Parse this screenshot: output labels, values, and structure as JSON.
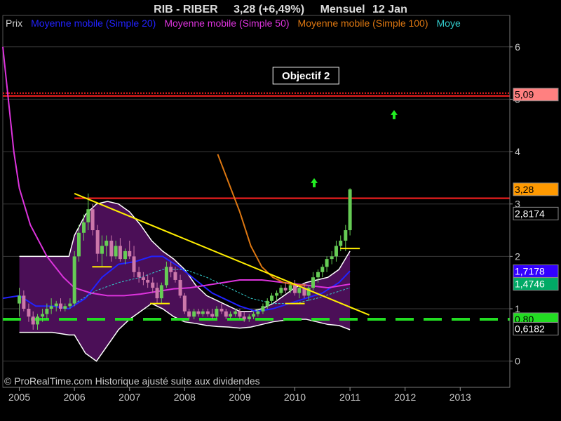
{
  "header": {
    "symbol": "RIB - RIBER",
    "quote": "3,28 (+6,49%)",
    "period": "Mensuel",
    "date": "12 Jan"
  },
  "legend": [
    {
      "label": "Prix",
      "color": "#cccccc"
    },
    {
      "label": "Moyenne mobile (Simple 20)",
      "color": "#2222ff"
    },
    {
      "label": "Moyenne mobile (Simple 50)",
      "color": "#dd33dd"
    },
    {
      "label": "Moyenne mobile (Simple 100)",
      "color": "#dd7711"
    },
    {
      "label": "Moye",
      "color": "#33cccc"
    }
  ],
  "copyright": "© ProRealTime.com Historique ajusté suite aux dividendes",
  "annotation": "Objectif 2",
  "colors": {
    "background": "#000000",
    "bollinger_fill": "#4b0f57",
    "up_candle": "#66cc55",
    "down_candle": "#cc77aa",
    "ma20": "#2222ff",
    "ma50": "#dd33dd",
    "ma100": "#dd7711",
    "ma_cyan": "#33cccc",
    "target_line": "#ff2020",
    "resistance_line": "#ff2020",
    "support_line": "#22dd22",
    "trendline": "#ffee00",
    "arrow": "#22ee22"
  },
  "chart_data": {
    "type": "candlestick",
    "x_axis": {
      "ticks": [
        "2005",
        "2006",
        "2007",
        "2008",
        "2009",
        "2010",
        "2011",
        "2012",
        "2013"
      ],
      "range": [
        2004.7,
        2013.9
      ]
    },
    "y_axis": {
      "ticks": [
        0,
        1,
        2,
        3,
        4,
        5,
        6
      ],
      "tick_labels": [
        "0",
        "1",
        "2",
        "3",
        "4",
        "5",
        "6"
      ],
      "range": [
        -0.5,
        6.6
      ],
      "position": "right"
    },
    "grid": true,
    "price_labels": [
      {
        "text": "5,09",
        "value": 5.09,
        "bg": "#ff8080",
        "fg": "#000000"
      },
      {
        "text": "3,28",
        "value": 3.28,
        "bg": "#ff9900",
        "fg": "#000000"
      },
      {
        "text": "2,8174",
        "value": 2.8174,
        "bg": "#000000",
        "fg": "#ffffff"
      },
      {
        "text": "1,7178",
        "value": 1.7178,
        "bg": "#3300ff",
        "fg": "#ffffff"
      },
      {
        "text": "1,4746",
        "value": 1.4746,
        "bg": "#00aa66",
        "fg": "#ffffff"
      },
      {
        "text": "0,80",
        "value": 0.8,
        "bg": "#22dd22",
        "fg": "#000000"
      },
      {
        "text": "0,6182",
        "value": 0.6182,
        "bg": "#000000",
        "fg": "#ffffff"
      }
    ],
    "hlines": [
      {
        "name": "objectif",
        "value": 5.09,
        "style": "double-dotted"
      },
      {
        "name": "resistance",
        "value": 3.11,
        "from_x": 2006.0,
        "style": "solid"
      },
      {
        "name": "support",
        "value": 0.8,
        "style": "dashed"
      }
    ],
    "trendline": {
      "x": [
        2006.0,
        2011.35
      ],
      "y": [
        3.2,
        0.88
      ]
    },
    "arrows": [
      {
        "x": 2010.35,
        "y": 3.4
      },
      {
        "x": 2011.8,
        "y": 4.7
      }
    ],
    "annotation_pos": {
      "x": 2010.2,
      "y": 5.45
    },
    "bollinger": {
      "x": [
        2005.0,
        2005.3,
        2005.6,
        2005.9,
        2006.0,
        2006.2,
        2006.4,
        2006.6,
        2006.8,
        2007.0,
        2007.2,
        2007.4,
        2007.6,
        2007.8,
        2008.0,
        2008.2,
        2008.4,
        2008.6,
        2008.8,
        2009.0,
        2009.2,
        2009.4,
        2009.6,
        2009.8,
        2010.0,
        2010.2,
        2010.4,
        2010.6,
        2010.8,
        2011.0
      ],
      "upper": [
        2.0,
        2.0,
        2.0,
        2.0,
        2.4,
        2.8,
        3.0,
        3.05,
        3.0,
        2.85,
        2.6,
        2.3,
        2.1,
        1.95,
        1.75,
        1.45,
        1.25,
        1.15,
        1.05,
        0.95,
        0.95,
        1.0,
        1.1,
        1.25,
        1.4,
        1.5,
        1.55,
        1.6,
        1.75,
        2.1
      ],
      "lower": [
        0.55,
        0.55,
        0.55,
        0.5,
        0.5,
        0.15,
        0.0,
        0.3,
        0.6,
        0.8,
        0.95,
        1.1,
        1.0,
        0.85,
        0.75,
        0.72,
        0.68,
        0.66,
        0.65,
        0.63,
        0.65,
        0.7,
        0.75,
        0.78,
        0.8,
        0.8,
        0.75,
        0.7,
        0.68,
        0.6
      ]
    },
    "series": [
      {
        "name": "Moyenne mobile (Simple 20)",
        "color_key": "ma20",
        "x": [
          2004.7,
          2005.0,
          2005.3,
          2005.6,
          2005.9,
          2006.2,
          2006.5,
          2006.8,
          2007.1,
          2007.4,
          2007.6,
          2007.9,
          2008.2,
          2008.5,
          2008.8,
          2009.0,
          2009.3,
          2009.6,
          2009.9,
          2010.2,
          2010.5,
          2010.8,
          2011.0
        ],
        "y": [
          1.2,
          1.25,
          1.05,
          1.05,
          1.0,
          1.2,
          1.6,
          1.85,
          1.9,
          2.0,
          2.0,
          1.8,
          1.55,
          1.3,
          1.15,
          1.05,
          0.95,
          1.0,
          1.1,
          1.2,
          1.3,
          1.5,
          1.72
        ]
      },
      {
        "name": "Moyenne mobile (Simple 50)",
        "color_key": "ma50",
        "x": [
          2004.7,
          2004.8,
          2004.9,
          2005.0,
          2005.2,
          2005.5,
          2005.8,
          2006.0,
          2006.3,
          2006.6,
          2006.9,
          2007.2,
          2007.5,
          2007.8,
          2008.1,
          2008.4,
          2008.7,
          2009.0,
          2009.4,
          2009.8,
          2010.2,
          2010.6,
          2011.0
        ],
        "y": [
          6.0,
          5.0,
          4.0,
          3.3,
          2.6,
          2.0,
          1.6,
          1.4,
          1.3,
          1.25,
          1.25,
          1.28,
          1.33,
          1.38,
          1.4,
          1.45,
          1.5,
          1.55,
          1.55,
          1.5,
          1.45,
          1.4,
          1.47
        ]
      },
      {
        "name": "Moyenne mobile (Simple 100)",
        "color_key": "ma100",
        "x": [
          2008.6,
          2008.8,
          2009.0,
          2009.2,
          2009.4,
          2009.6,
          2009.8,
          2010.0,
          2010.2
        ],
        "y": [
          3.95,
          3.4,
          2.85,
          2.2,
          1.8,
          1.6,
          1.5,
          1.45,
          1.45
        ]
      },
      {
        "name": "Moye",
        "color_key": "ma_cyan",
        "x": [
          2006.0,
          2006.4,
          2006.8,
          2007.2,
          2007.6,
          2008.0,
          2008.4,
          2008.8,
          2009.2,
          2009.6,
          2010.0,
          2010.4,
          2011.0
        ],
        "y": [
          1.1,
          1.35,
          1.5,
          1.6,
          1.75,
          1.75,
          1.6,
          1.4,
          1.2,
          1.1,
          1.1,
          1.2,
          1.4
        ]
      }
    ],
    "candles": [
      {
        "x": 2005.0,
        "o": 1.1,
        "h": 1.4,
        "l": 0.85,
        "c": 1.25
      },
      {
        "x": 2005.08,
        "o": 1.25,
        "h": 1.35,
        "l": 0.95,
        "c": 1.0
      },
      {
        "x": 2005.17,
        "o": 1.0,
        "h": 1.1,
        "l": 0.75,
        "c": 0.85
      },
      {
        "x": 2005.25,
        "o": 0.85,
        "h": 0.95,
        "l": 0.6,
        "c": 0.7
      },
      {
        "x": 2005.33,
        "o": 0.7,
        "h": 0.9,
        "l": 0.6,
        "c": 0.85
      },
      {
        "x": 2005.42,
        "o": 0.85,
        "h": 1.0,
        "l": 0.75,
        "c": 0.9
      },
      {
        "x": 2005.5,
        "o": 0.9,
        "h": 1.1,
        "l": 0.8,
        "c": 1.0
      },
      {
        "x": 2005.58,
        "o": 1.0,
        "h": 1.2,
        "l": 0.9,
        "c": 1.05
      },
      {
        "x": 2005.67,
        "o": 1.05,
        "h": 1.15,
        "l": 0.95,
        "c": 1.1
      },
      {
        "x": 2005.75,
        "o": 1.1,
        "h": 1.2,
        "l": 0.95,
        "c": 1.0
      },
      {
        "x": 2005.83,
        "o": 1.0,
        "h": 1.1,
        "l": 0.95,
        "c": 1.05
      },
      {
        "x": 2005.92,
        "o": 1.05,
        "h": 1.2,
        "l": 1.0,
        "c": 1.1
      },
      {
        "x": 2006.0,
        "o": 1.1,
        "h": 2.1,
        "l": 1.05,
        "c": 2.0
      },
      {
        "x": 2006.08,
        "o": 2.0,
        "h": 2.6,
        "l": 1.9,
        "c": 2.45
      },
      {
        "x": 2006.17,
        "o": 2.45,
        "h": 2.8,
        "l": 2.3,
        "c": 2.65
      },
      {
        "x": 2006.25,
        "o": 2.65,
        "h": 3.2,
        "l": 2.5,
        "c": 2.9
      },
      {
        "x": 2006.33,
        "o": 2.9,
        "h": 3.0,
        "l": 2.4,
        "c": 2.5
      },
      {
        "x": 2006.42,
        "o": 2.5,
        "h": 2.6,
        "l": 1.9,
        "c": 2.05
      },
      {
        "x": 2006.5,
        "o": 2.05,
        "h": 2.4,
        "l": 1.8,
        "c": 2.2
      },
      {
        "x": 2006.58,
        "o": 2.2,
        "h": 2.4,
        "l": 2.0,
        "c": 2.3
      },
      {
        "x": 2006.67,
        "o": 2.3,
        "h": 2.4,
        "l": 1.9,
        "c": 2.0
      },
      {
        "x": 2006.75,
        "o": 2.0,
        "h": 2.3,
        "l": 1.95,
        "c": 2.2
      },
      {
        "x": 2006.83,
        "o": 2.2,
        "h": 2.35,
        "l": 1.9,
        "c": 1.95
      },
      {
        "x": 2006.92,
        "o": 1.95,
        "h": 2.15,
        "l": 1.85,
        "c": 2.1
      },
      {
        "x": 2007.0,
        "o": 2.1,
        "h": 2.3,
        "l": 1.95,
        "c": 2.0
      },
      {
        "x": 2007.08,
        "o": 2.0,
        "h": 2.2,
        "l": 1.6,
        "c": 1.7
      },
      {
        "x": 2007.17,
        "o": 1.7,
        "h": 1.8,
        "l": 1.5,
        "c": 1.6
      },
      {
        "x": 2007.25,
        "o": 1.6,
        "h": 1.7,
        "l": 1.45,
        "c": 1.55
      },
      {
        "x": 2007.33,
        "o": 1.55,
        "h": 1.65,
        "l": 1.4,
        "c": 1.5
      },
      {
        "x": 2007.42,
        "o": 1.5,
        "h": 1.6,
        "l": 1.3,
        "c": 1.4
      },
      {
        "x": 2007.5,
        "o": 1.4,
        "h": 1.5,
        "l": 1.1,
        "c": 1.2
      },
      {
        "x": 2007.58,
        "o": 1.2,
        "h": 1.5,
        "l": 1.1,
        "c": 1.45
      },
      {
        "x": 2007.67,
        "o": 1.45,
        "h": 1.9,
        "l": 1.4,
        "c": 1.8
      },
      {
        "x": 2007.75,
        "o": 1.8,
        "h": 1.9,
        "l": 1.6,
        "c": 1.7
      },
      {
        "x": 2007.83,
        "o": 1.7,
        "h": 1.8,
        "l": 1.5,
        "c": 1.55
      },
      {
        "x": 2007.92,
        "o": 1.55,
        "h": 1.65,
        "l": 1.2,
        "c": 1.25
      },
      {
        "x": 2008.0,
        "o": 1.25,
        "h": 1.3,
        "l": 0.9,
        "c": 0.95
      },
      {
        "x": 2008.08,
        "o": 0.95,
        "h": 1.0,
        "l": 0.8,
        "c": 0.85
      },
      {
        "x": 2008.17,
        "o": 0.85,
        "h": 1.0,
        "l": 0.8,
        "c": 0.95
      },
      {
        "x": 2008.25,
        "o": 0.95,
        "h": 1.0,
        "l": 0.85,
        "c": 0.9
      },
      {
        "x": 2008.33,
        "o": 0.9,
        "h": 1.0,
        "l": 0.85,
        "c": 0.95
      },
      {
        "x": 2008.42,
        "o": 0.95,
        "h": 1.0,
        "l": 0.85,
        "c": 0.9
      },
      {
        "x": 2008.5,
        "o": 0.9,
        "h": 1.0,
        "l": 0.8,
        "c": 0.85
      },
      {
        "x": 2008.58,
        "o": 0.85,
        "h": 1.05,
        "l": 0.8,
        "c": 1.0
      },
      {
        "x": 2008.67,
        "o": 1.0,
        "h": 1.1,
        "l": 0.9,
        "c": 0.95
      },
      {
        "x": 2008.75,
        "o": 0.95,
        "h": 1.0,
        "l": 0.8,
        "c": 0.85
      },
      {
        "x": 2008.83,
        "o": 0.85,
        "h": 0.95,
        "l": 0.8,
        "c": 0.9
      },
      {
        "x": 2008.92,
        "o": 0.9,
        "h": 1.0,
        "l": 0.85,
        "c": 0.95
      },
      {
        "x": 2009.0,
        "o": 0.95,
        "h": 1.0,
        "l": 0.8,
        "c": 0.85
      },
      {
        "x": 2009.08,
        "o": 0.85,
        "h": 0.95,
        "l": 0.75,
        "c": 0.8
      },
      {
        "x": 2009.17,
        "o": 0.8,
        "h": 0.9,
        "l": 0.75,
        "c": 0.85
      },
      {
        "x": 2009.25,
        "o": 0.85,
        "h": 0.95,
        "l": 0.8,
        "c": 0.9
      },
      {
        "x": 2009.33,
        "o": 0.9,
        "h": 1.0,
        "l": 0.85,
        "c": 0.95
      },
      {
        "x": 2009.42,
        "o": 0.95,
        "h": 1.1,
        "l": 0.9,
        "c": 1.05
      },
      {
        "x": 2009.5,
        "o": 1.05,
        "h": 1.2,
        "l": 1.0,
        "c": 1.15
      },
      {
        "x": 2009.58,
        "o": 1.15,
        "h": 1.3,
        "l": 1.1,
        "c": 1.25
      },
      {
        "x": 2009.67,
        "o": 1.25,
        "h": 1.35,
        "l": 1.15,
        "c": 1.3
      },
      {
        "x": 2009.75,
        "o": 1.3,
        "h": 1.45,
        "l": 1.25,
        "c": 1.4
      },
      {
        "x": 2009.83,
        "o": 1.4,
        "h": 1.5,
        "l": 1.3,
        "c": 1.35
      },
      {
        "x": 2009.92,
        "o": 1.35,
        "h": 1.5,
        "l": 1.3,
        "c": 1.45
      },
      {
        "x": 2010.0,
        "o": 1.45,
        "h": 1.55,
        "l": 1.25,
        "c": 1.3
      },
      {
        "x": 2010.08,
        "o": 1.3,
        "h": 1.45,
        "l": 1.2,
        "c": 1.4
      },
      {
        "x": 2010.17,
        "o": 1.4,
        "h": 1.5,
        "l": 1.2,
        "c": 1.25
      },
      {
        "x": 2010.25,
        "o": 1.25,
        "h": 1.45,
        "l": 1.15,
        "c": 1.4
      },
      {
        "x": 2010.33,
        "o": 1.4,
        "h": 1.7,
        "l": 1.35,
        "c": 1.6
      },
      {
        "x": 2010.42,
        "o": 1.6,
        "h": 1.75,
        "l": 1.5,
        "c": 1.7
      },
      {
        "x": 2010.5,
        "o": 1.7,
        "h": 1.85,
        "l": 1.6,
        "c": 1.8
      },
      {
        "x": 2010.58,
        "o": 1.8,
        "h": 2.0,
        "l": 1.7,
        "c": 1.95
      },
      {
        "x": 2010.67,
        "o": 1.95,
        "h": 2.1,
        "l": 1.85,
        "c": 2.0
      },
      {
        "x": 2010.75,
        "o": 2.0,
        "h": 2.3,
        "l": 1.9,
        "c": 2.2
      },
      {
        "x": 2010.83,
        "o": 2.2,
        "h": 2.4,
        "l": 2.1,
        "c": 2.3
      },
      {
        "x": 2010.92,
        "o": 2.3,
        "h": 2.6,
        "l": 2.1,
        "c": 2.5
      },
      {
        "x": 2011.0,
        "o": 2.5,
        "h": 3.3,
        "l": 2.4,
        "c": 3.28
      }
    ],
    "support_markers": [
      {
        "x": 2006.5,
        "y": 1.8
      },
      {
        "x": 2007.55,
        "y": 1.1
      },
      {
        "x": 2010.0,
        "y": 1.1
      },
      {
        "x": 2011.0,
        "y": 2.15
      }
    ]
  }
}
